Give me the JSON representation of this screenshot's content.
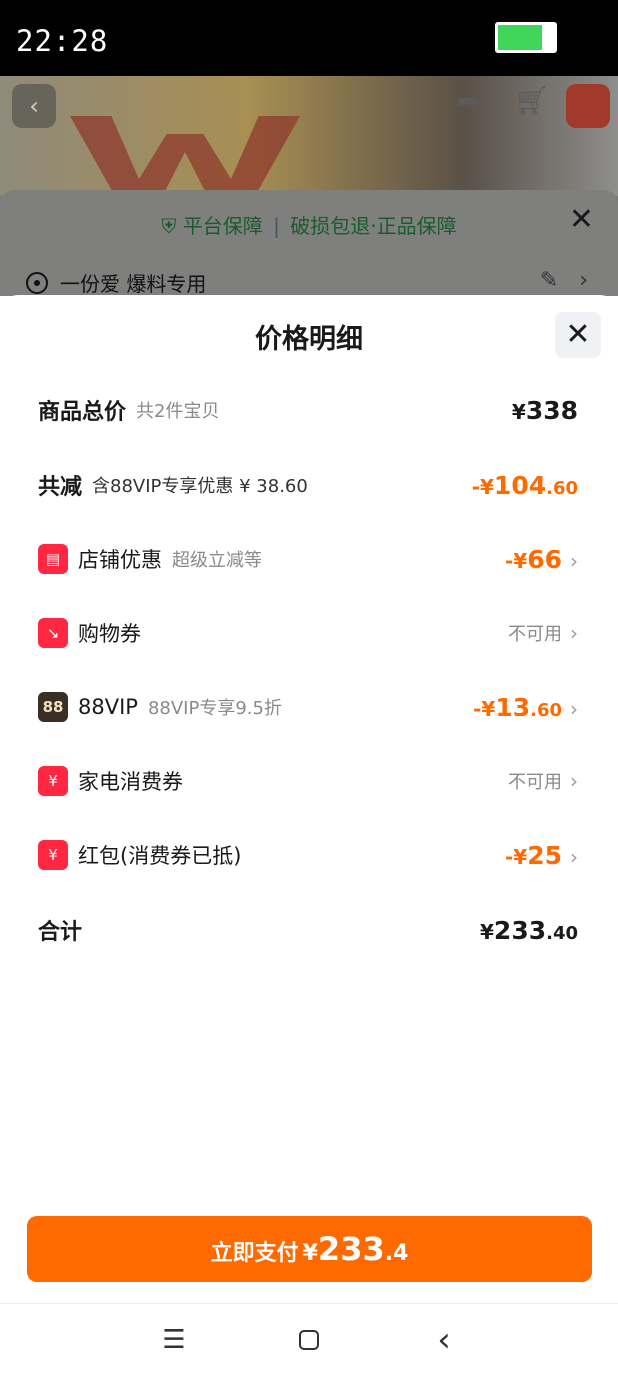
{
  "status_bar": {
    "time": "22:28",
    "battery_level": 0.75
  },
  "background": {
    "guarantee_left": "平台保障",
    "guarantee_sep": "|",
    "guarantee_right": "破损包退·正品保障",
    "close_icon": "✕",
    "address": "一份爱 爆料专用",
    "edit_icon": "✎",
    "chevron": "›"
  },
  "panel": {
    "title": "价格明细",
    "close_icon": "✕",
    "goods_total": {
      "label": "商品总价",
      "sub": "共2件宝贝",
      "yen": "¥",
      "amount": "338"
    },
    "total_reduce": {
      "label": "共减",
      "sub": "含88VIP专享优惠 ¥ 38.60",
      "yen": "-¥",
      "int": "104",
      "dec": ".60"
    },
    "shop_discount": {
      "icon": "store-icon",
      "label": "店铺优惠",
      "sub": "超级立减等",
      "yen": "-¥",
      "int": "66",
      "dec": ""
    },
    "coupon": {
      "icon": "coupon-icon",
      "label": "购物券",
      "status": "不可用"
    },
    "vip": {
      "icon": "88vip-icon",
      "icon_text": "88",
      "label": "88VIP",
      "sub": "88VIP专享9.5折",
      "yen": "-¥",
      "int": "13",
      "dec": ".60"
    },
    "appliance": {
      "icon": "appliance-coupon-icon",
      "label": "家电消费券",
      "status": "不可用"
    },
    "red_packet": {
      "icon": "red-packet-icon",
      "label": "红包(消费券已抵)",
      "yen": "-¥",
      "int": "25",
      "dec": ""
    },
    "total": {
      "label": "合计",
      "yen": "¥",
      "int": "233",
      "dec": ".40"
    },
    "chevron": "›"
  },
  "pay_button": {
    "label": "立即支付",
    "yen": "¥",
    "int": "233",
    "dec": ".4"
  },
  "nav_bar": {
    "menu_icon": "☰",
    "back_icon": "‹"
  },
  "colors": {
    "accent": "#ff6a00",
    "icon_red": "#ff2742",
    "guarantee_green": "#1a5a2e"
  }
}
